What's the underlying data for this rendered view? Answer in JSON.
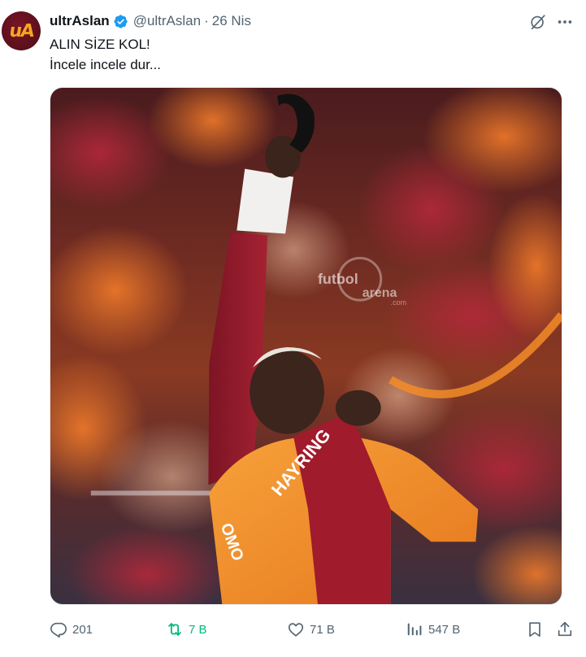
{
  "tweet": {
    "author_name": "ultrAslan",
    "handle": "@ultrAslan",
    "separator": "·",
    "date": "26 Nis",
    "avatar_text": "uA",
    "text_line1": "ALIN SİZE KOL!",
    "text_line2": "İncele incele dur...",
    "media": {
      "watermark_brand": "futbol",
      "watermark_brand2": "arena",
      "watermark_domain": ".com",
      "shirt_text": "HAYRING",
      "shirt_side_text": "OMO",
      "icon": "photo-of-player"
    }
  },
  "actions": {
    "replies": "201",
    "reposts": "7 B",
    "likes": "71 B",
    "views": "547 B"
  },
  "colors": {
    "verified_blue": "#1d9bf0",
    "repost_green": "#00ba7c",
    "muted_gray": "#536471",
    "galatasaray_red": "#a01b2c",
    "galatasaray_orange": "#f28c28"
  }
}
